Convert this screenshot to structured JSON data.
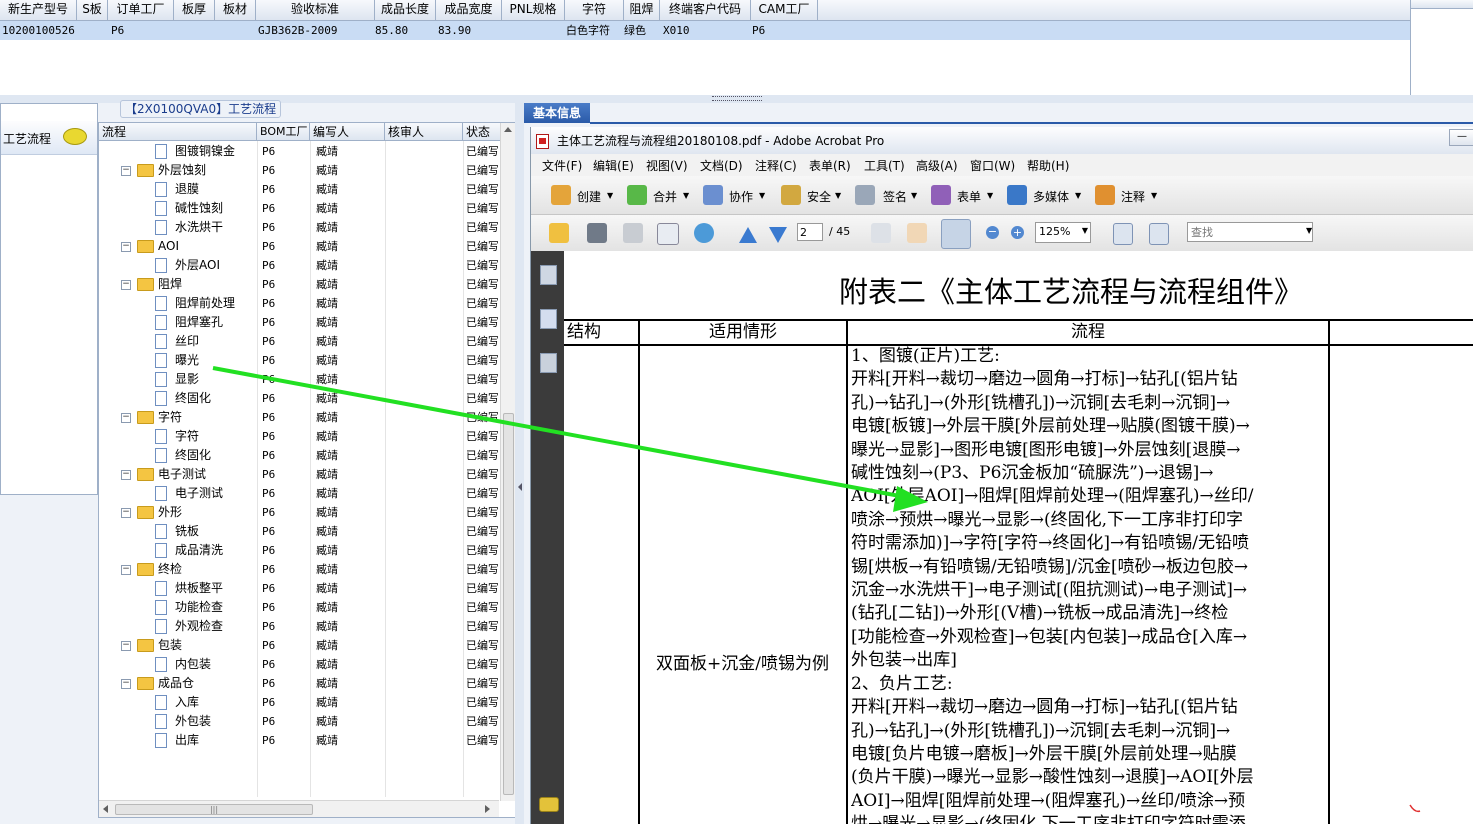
{
  "top_grid": {
    "headers": [
      "新生产型号",
      "S板",
      "订单工厂",
      "板厚",
      "板材",
      "验收标准",
      "成品长度",
      "成品宽度",
      "PNL规格",
      "字符",
      "阻焊",
      "终端客户代码",
      "CAM工厂"
    ],
    "row": {
      "model": "10200100526",
      "plant": "P6",
      "standard": "GJB362B-2009",
      "length": "85.80",
      "width": "83.90",
      "char": "白色字符",
      "solder": "绿色",
      "customer": "X010",
      "cam": "P6"
    }
  },
  "left_tab": {
    "label": "工艺流程"
  },
  "process_panel": {
    "title": "【2X0100QVA0】工艺流程"
  },
  "tree": {
    "columns": [
      "流程",
      "BOM工厂",
      "编写人",
      "核审人",
      "状态"
    ],
    "rows": [
      {
        "label": "图镀铜镍金",
        "level": 1,
        "folder": false,
        "plant": "P6",
        "writer": "臧靖",
        "status": "已编写"
      },
      {
        "label": "外层蚀刻",
        "level": 0,
        "folder": true,
        "plant": "P6",
        "writer": "臧靖",
        "status": "已编写"
      },
      {
        "label": "退膜",
        "level": 1,
        "folder": false,
        "plant": "P6",
        "writer": "臧靖",
        "status": "已编写"
      },
      {
        "label": "碱性蚀刻",
        "level": 1,
        "folder": false,
        "plant": "P6",
        "writer": "臧靖",
        "status": "已编写"
      },
      {
        "label": "水洗烘干",
        "level": 1,
        "folder": false,
        "plant": "P6",
        "writer": "臧靖",
        "status": "已编写"
      },
      {
        "label": "AOI",
        "level": 0,
        "folder": true,
        "plant": "P6",
        "writer": "臧靖",
        "status": "已编写"
      },
      {
        "label": "外层AOI",
        "level": 1,
        "folder": false,
        "plant": "P6",
        "writer": "臧靖",
        "status": "已编写"
      },
      {
        "label": "阻焊",
        "level": 0,
        "folder": true,
        "plant": "P6",
        "writer": "臧靖",
        "status": "已编写"
      },
      {
        "label": "阻焊前处理",
        "level": 1,
        "folder": false,
        "plant": "P6",
        "writer": "臧靖",
        "status": "已编写"
      },
      {
        "label": "阻焊塞孔",
        "level": 1,
        "folder": false,
        "plant": "P6",
        "writer": "臧靖",
        "status": "已编写"
      },
      {
        "label": "丝印",
        "level": 1,
        "folder": false,
        "plant": "P6",
        "writer": "臧靖",
        "status": "已编写"
      },
      {
        "label": "曝光",
        "level": 1,
        "folder": false,
        "plant": "P6",
        "writer": "臧靖",
        "status": "已编写"
      },
      {
        "label": "显影",
        "level": 1,
        "folder": false,
        "plant": "P6",
        "writer": "臧靖",
        "status": "已编写"
      },
      {
        "label": "终固化",
        "level": 1,
        "folder": false,
        "plant": "P6",
        "writer": "臧靖",
        "status": "已编写"
      },
      {
        "label": "字符",
        "level": 0,
        "folder": true,
        "plant": "P6",
        "writer": "臧靖",
        "status": "已编写"
      },
      {
        "label": "字符",
        "level": 1,
        "folder": false,
        "plant": "P6",
        "writer": "臧靖",
        "status": "已编写"
      },
      {
        "label": "终固化",
        "level": 1,
        "folder": false,
        "plant": "P6",
        "writer": "臧靖",
        "status": "已编写"
      },
      {
        "label": "电子测试",
        "level": 0,
        "folder": true,
        "plant": "P6",
        "writer": "臧靖",
        "status": "已编写"
      },
      {
        "label": "电子测试",
        "level": 1,
        "folder": false,
        "plant": "P6",
        "writer": "臧靖",
        "status": "已编写"
      },
      {
        "label": "外形",
        "level": 0,
        "folder": true,
        "plant": "P6",
        "writer": "臧靖",
        "status": "已编写"
      },
      {
        "label": "铣板",
        "level": 1,
        "folder": false,
        "plant": "P6",
        "writer": "臧靖",
        "status": "已编写"
      },
      {
        "label": "成品清洗",
        "level": 1,
        "folder": false,
        "plant": "P6",
        "writer": "臧靖",
        "status": "已编写"
      },
      {
        "label": "终检",
        "level": 0,
        "folder": true,
        "plant": "P6",
        "writer": "臧靖",
        "status": "已编写"
      },
      {
        "label": "烘板整平",
        "level": 1,
        "folder": false,
        "plant": "P6",
        "writer": "臧靖",
        "status": "已编写"
      },
      {
        "label": "功能检查",
        "level": 1,
        "folder": false,
        "plant": "P6",
        "writer": "臧靖",
        "status": "已编写"
      },
      {
        "label": "外观检查",
        "level": 1,
        "folder": false,
        "plant": "P6",
        "writer": "臧靖",
        "status": "已编写"
      },
      {
        "label": "包装",
        "level": 0,
        "folder": true,
        "plant": "P6",
        "writer": "臧靖",
        "status": "已编写"
      },
      {
        "label": "内包装",
        "level": 1,
        "folder": false,
        "plant": "P6",
        "writer": "臧靖",
        "status": "已编写"
      },
      {
        "label": "成品仓",
        "level": 0,
        "folder": true,
        "plant": "P6",
        "writer": "臧靖",
        "status": "已编写"
      },
      {
        "label": "入库",
        "level": 1,
        "folder": false,
        "plant": "P6",
        "writer": "臧靖",
        "status": "已编写"
      },
      {
        "label": "外包装",
        "level": 1,
        "folder": false,
        "plant": "P6",
        "writer": "臧靖",
        "status": "已编写"
      },
      {
        "label": "出库",
        "level": 1,
        "folder": false,
        "plant": "P6",
        "writer": "臧靖",
        "status": "已编写"
      }
    ]
  },
  "basic_info": {
    "tab": "基本信息"
  },
  "acrobat": {
    "title": "主体工艺流程与流程组20180108.pdf - Adobe Acrobat Pro",
    "menus": [
      "文件(F)",
      "编辑(E)",
      "视图(V)",
      "文档(D)",
      "注释(C)",
      "表单(R)",
      "工具(T)",
      "高级(A)",
      "窗口(W)",
      "帮助(H)"
    ],
    "toolbar1": [
      "创建",
      "合并",
      "协作",
      "安全",
      "签名",
      "表单",
      "多媒体",
      "注释"
    ],
    "page_current": "2",
    "page_total": "/ 45",
    "zoom": "125%",
    "find_placeholder": "查找"
  },
  "pdf": {
    "title": "附表二《主体工艺流程与流程组件》",
    "headers": [
      "结构",
      "适用情形",
      "流程"
    ],
    "scenario": "双面板+沉金/喷锡为例",
    "lines": [
      "1、图镀(正片)工艺:",
      "开料[开料→裁切→磨边→圆角→打标]→钻孔[(铝片钻",
      "孔)→钻孔]→(外形[铣槽孔])→沉铜[去毛刺→沉铜]→",
      "电镀[板镀]→外层干膜[外层前处理→贴膜(图镀干膜)→",
      "曝光→显影]→图形电镀[图形电镀]→外层蚀刻[退膜→",
      "碱性蚀刻→(P3、P6沉金板加“硫脲洗”)→退锡]→",
      "AOI[外层AOI]→阻焊[阻焊前处理→(阻焊塞孔)→丝印/",
      "喷涂→预烘→曝光→显影→(终固化,下一工序非打印字",
      "符时需添加)]→字符[字符→终固化]→有铅喷锡/无铅喷",
      "锡[烘板→有铅喷锡/无铅喷锡]/沉金[喷砂→板边包胶→",
      "沉金→水洗烘干]→电子测试[(阻抗测试)→电子测试]→",
      "(钻孔[二钻])→外形[(V槽)→铣板→成品清洗]→终检",
      "[功能检查→外观检查]→包装[内包装]→成品仓[入库→",
      "外包装→出库]",
      "2、负片工艺:",
      "开料[开料→裁切→磨边→圆角→打标]→钻孔[(铝片钻",
      "孔)→钻孔]→(外形[铣槽孔])→沉铜[去毛刺→沉铜]→",
      "电镀[负片电镀→磨板]→外层干膜[外层前处理→贴膜",
      "(负片干膜)→曝光→显影→酸性蚀刻→退膜]→AOI[外层",
      "AOI]→阻焊[阻焊前处理→(阻焊塞孔)→丝印/喷涂→预",
      "烘→曝光→显影→(终固化,下一工序非打印字符时需添"
    ]
  },
  "arrow_color": "#22e022"
}
